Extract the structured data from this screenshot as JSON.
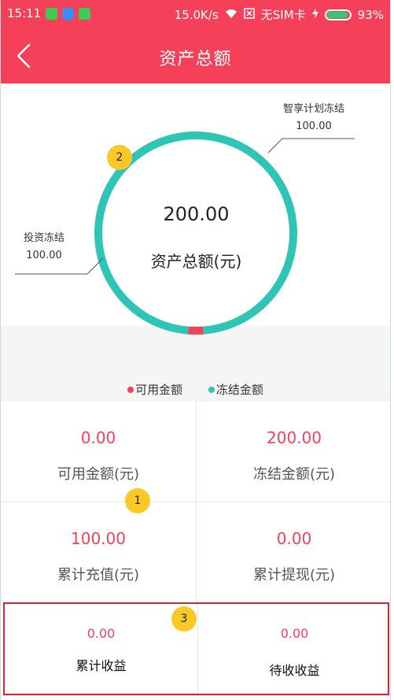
{
  "status_bar": {
    "time": "15:11",
    "network_speed": "15.0K/s",
    "sim": "无SIM卡",
    "battery": "93%",
    "battery_level": 0.93
  },
  "header": {
    "title": "资产总额",
    "back_icon": "chevron-left-icon"
  },
  "chart": {
    "total_value": "200.00",
    "total_label": "资产总额(元)",
    "callout_right": {
      "label": "智享计划冻结",
      "value": "100.00"
    },
    "callout_left": {
      "label": "投资冻结",
      "value": "100.00"
    },
    "legend": [
      {
        "label": "可用金额",
        "color": "#f5405a"
      },
      {
        "label": "冻结金额",
        "color": "#2ec4b6"
      }
    ]
  },
  "chart_data": {
    "type": "pie",
    "slices": [
      {
        "name": "智享计划冻结",
        "value": 100.0,
        "color": "#2ec4b6"
      },
      {
        "name": "投资冻结",
        "value": 100.0,
        "color": "#2ec4b6"
      },
      {
        "name": "可用金额",
        "value": 0.0,
        "color": "#f5405a"
      }
    ]
  },
  "grid": {
    "available": {
      "value": "0.00",
      "label": "可用金额(元)"
    },
    "frozen": {
      "value": "200.00",
      "label": "冻结金额(元)"
    },
    "recharge": {
      "value": "100.00",
      "label": "累计充值(元)"
    },
    "withdraw": {
      "value": "0.00",
      "label": "累计提现(元)"
    }
  },
  "earnings": {
    "cumulative": {
      "value": "0.00",
      "label": "累计收益"
    },
    "pending": {
      "value": "0.00",
      "label": "待收收益"
    }
  },
  "badges": {
    "one": "1",
    "two": "2",
    "three": "3"
  },
  "colors": {
    "brand": "#f5405a",
    "ring": "#2ec4b6",
    "badge": "#fbc927"
  }
}
